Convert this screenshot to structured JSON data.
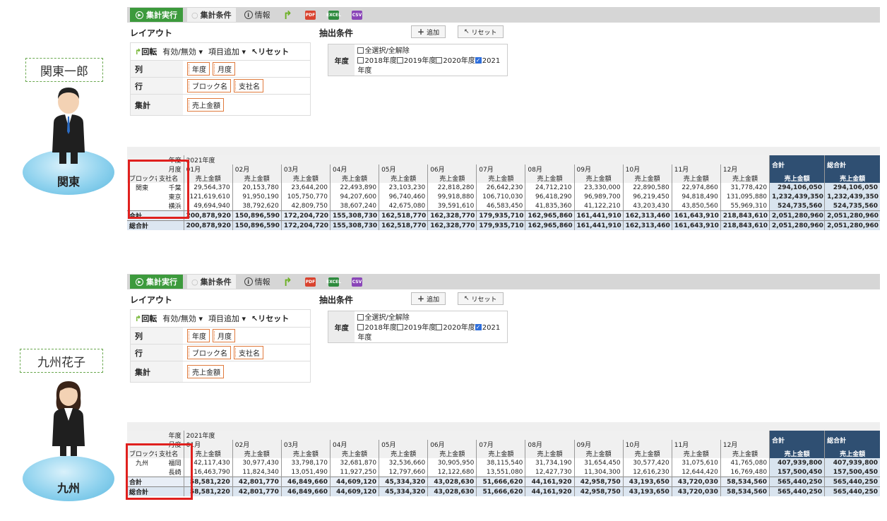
{
  "toolbar": {
    "run": "集計実行",
    "conditions": "集計条件",
    "info": "情報",
    "pdf": "PDF",
    "excel": "EXCEL",
    "csv": "CSV"
  },
  "layout": {
    "title": "レイアウト",
    "rotate": "回転",
    "enable": "有効/無効",
    "add_item": "項目追加",
    "reset": "リセット",
    "row_labels": [
      "列",
      "行",
      "集計"
    ],
    "columns_chips": [
      "年度",
      "月度"
    ],
    "rows_chips": [
      "ブロック名",
      "支社名"
    ],
    "agg_chips": [
      "売上金額"
    ]
  },
  "extract": {
    "title": "抽出条件",
    "add": "追加",
    "reset": "リセット",
    "year_label": "年度",
    "select_all": "全選択/全解除",
    "years": [
      "2018年度",
      "2019年度",
      "2020年度",
      "2021年度"
    ],
    "checked_year": "2021年度"
  },
  "grid_header": {
    "year_label": "年度",
    "year_value": "2021年度",
    "month_label": "月度",
    "block_label": "ブロック名",
    "branch_label": "支社名",
    "months": [
      "01月",
      "02月",
      "03月",
      "04月",
      "05月",
      "06月",
      "07月",
      "08月",
      "09月",
      "10月",
      "11月",
      "12月"
    ],
    "total": "合計",
    "grand_total": "総合計",
    "measure": "売上金額"
  },
  "personas": [
    {
      "name": "関東一郎",
      "region": "関東"
    },
    {
      "name": "九州花子",
      "region": "九州"
    }
  ],
  "kanto": {
    "block": "関東",
    "rows": [
      {
        "branch": "千葉",
        "values": [
          "29,564,370",
          "20,153,780",
          "23,644,200",
          "22,493,890",
          "23,103,230",
          "22,818,280",
          "26,642,230",
          "24,712,210",
          "23,330,000",
          "22,890,580",
          "22,974,860",
          "31,778,420"
        ],
        "total": "294,106,050",
        "grand": "294,106,050"
      },
      {
        "branch": "東京",
        "values": [
          "121,619,610",
          "91,950,190",
          "105,750,770",
          "94,207,600",
          "96,740,460",
          "99,918,880",
          "106,710,030",
          "96,418,290",
          "96,989,700",
          "96,219,450",
          "94,818,490",
          "131,095,880"
        ],
        "total": "1,232,439,350",
        "grand": "1,232,439,350"
      },
      {
        "branch": "横浜",
        "values": [
          "49,694,940",
          "38,792,620",
          "42,809,750",
          "38,607,240",
          "42,675,080",
          "39,591,610",
          "46,583,450",
          "41,835,360",
          "41,122,210",
          "43,203,430",
          "43,850,560",
          "55,969,310"
        ],
        "total": "524,735,560",
        "grand": "524,735,560"
      }
    ],
    "subtotal_label": "合計",
    "subtotal": [
      "200,878,920",
      "150,896,590",
      "172,204,720",
      "155,308,730",
      "162,518,770",
      "162,328,770",
      "179,935,710",
      "162,965,860",
      "161,441,910",
      "162,313,460",
      "161,643,910",
      "218,843,610"
    ],
    "subtotal_total": "2,051,280,960",
    "subtotal_grand": "2,051,280,960",
    "grand_label": "総合計",
    "grand": [
      "200,878,920",
      "150,896,590",
      "172,204,720",
      "155,308,730",
      "162,518,770",
      "162,328,770",
      "179,935,710",
      "162,965,860",
      "161,441,910",
      "162,313,460",
      "161,643,910",
      "218,843,610"
    ],
    "grand_total": "2,051,280,960",
    "grand_grand": "2,051,280,960"
  },
  "kyushu": {
    "block": "九州",
    "rows": [
      {
        "branch": "福岡",
        "values": [
          "42,117,430",
          "30,977,430",
          "33,798,170",
          "32,681,870",
          "32,536,660",
          "30,905,950",
          "38,115,540",
          "31,734,190",
          "31,654,450",
          "30,577,420",
          "31,075,610",
          "41,765,080"
        ],
        "total": "407,939,800",
        "grand": "407,939,800"
      },
      {
        "branch": "長崎",
        "values": [
          "16,463,790",
          "11,824,340",
          "13,051,490",
          "11,927,250",
          "12,797,660",
          "12,122,680",
          "13,551,080",
          "12,427,730",
          "11,304,300",
          "12,616,230",
          "12,644,420",
          "16,769,480"
        ],
        "total": "157,500,450",
        "grand": "157,500,450"
      }
    ],
    "subtotal_label": "合計",
    "subtotal": [
      "58,581,220",
      "42,801,770",
      "46,849,660",
      "44,609,120",
      "45,334,320",
      "43,028,630",
      "51,666,620",
      "44,161,920",
      "42,958,750",
      "43,193,650",
      "43,720,030",
      "58,534,560"
    ],
    "subtotal_total": "565,440,250",
    "subtotal_grand": "565,440,250",
    "grand_label": "総合計",
    "grand": [
      "58,581,220",
      "42,801,770",
      "46,849,660",
      "44,609,120",
      "45,334,320",
      "43,028,630",
      "51,666,620",
      "44,161,920",
      "42,958,750",
      "43,193,650",
      "43,720,030",
      "58,534,560"
    ],
    "grand_total": "565,440,250",
    "grand_grand": "565,440,250"
  },
  "colors": {
    "run_green": "#3c9a3c",
    "header_dark": "#2f4f72",
    "chip_border": "#e07a3c",
    "highlight_red": "#e0201e"
  }
}
